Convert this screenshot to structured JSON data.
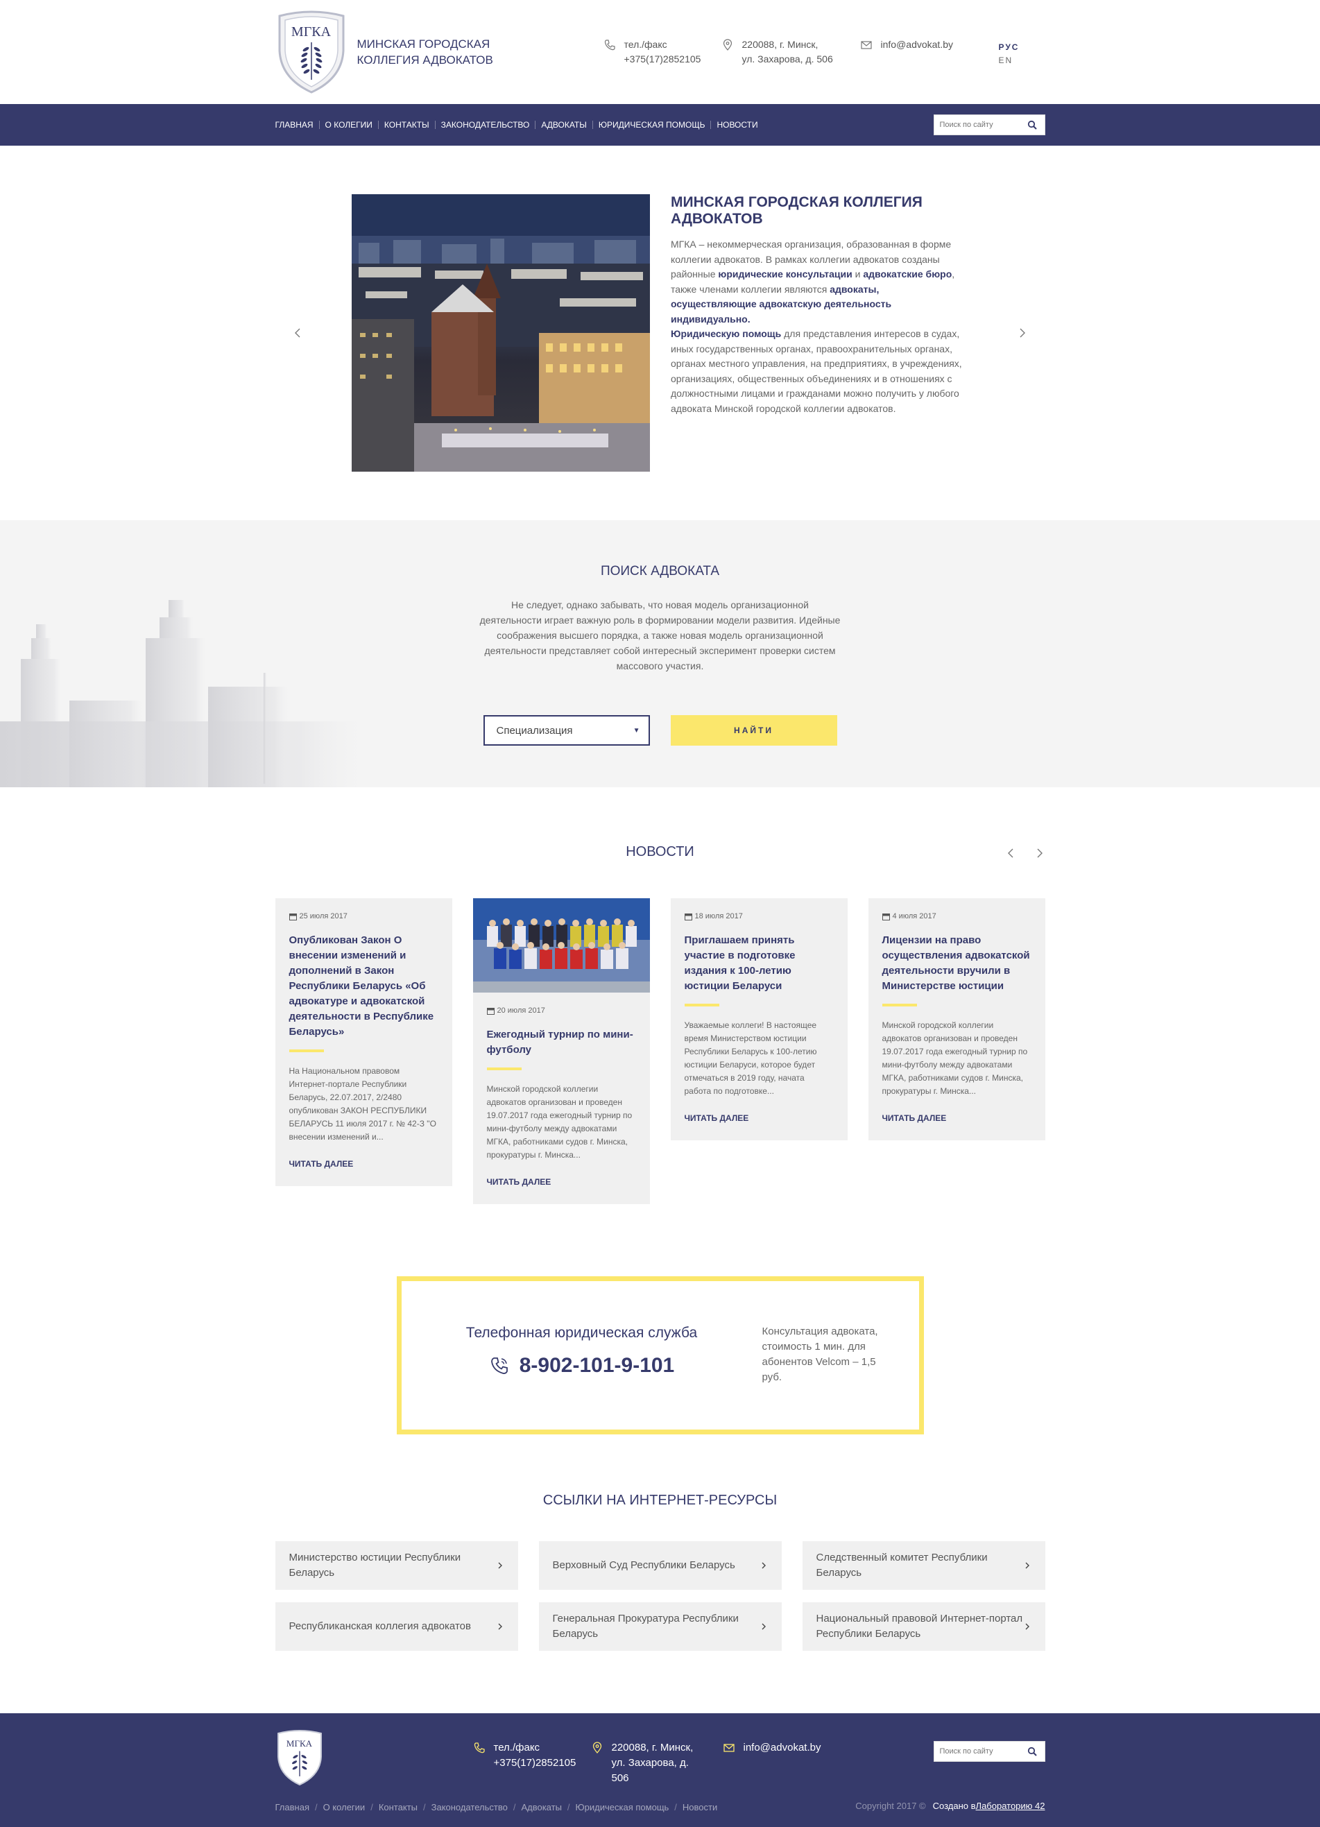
{
  "header": {
    "logo_text": "МГКА",
    "brand_line1": "МИНСКАЯ ГОРОДСКАЯ",
    "brand_line2": "КОЛЛЕГИЯ АДВОКАТОВ",
    "phone_label": "тел./факс",
    "phone_value": "+375(17)2852105",
    "addr_line1": "220088, г. Минск,",
    "addr_line2": "ул. Захарова, д. 506",
    "email": "info@advokat.by",
    "lang_active": "РУС",
    "lang_other": "EN"
  },
  "nav": {
    "items": [
      "ГЛАВНАЯ",
      "О КОЛЕГИИ",
      "КОНТАКТЫ",
      "ЗАКОНОДАТЕЛЬСТВО",
      "АДВОКАТЫ",
      "ЮРИДИЧЕСКАЯ ПОМОЩЬ",
      "НОВОСТИ"
    ],
    "search_placeholder": "Поиск по сайту"
  },
  "hero": {
    "title": "МИНСКАЯ ГОРОДСКАЯ КОЛЛЕГИЯ АДВОКАТОВ",
    "p1": "МГКА – некоммерческая организация, образованная в форме коллегии адвокатов. В рамках коллегии адвокатов созданы районные ",
    "b1": "юридические консультации",
    "p2": " и ",
    "b2": "адвокатские бюро",
    "p3": ", также членами коллегии являются ",
    "b3": "адвокаты, осуществляющие адвокатскую деятельность индивидуально.",
    "b4": "Юридическую помощь",
    "p4": " для представления интересов в судах, иных государственных органах, правоохранительных органах, органах местного управления, на предприятиях, в учреждениях, организациях, общественных объединениях и в отношениях с должностными лицами и гражданами можно получить у любого адвоката Минской городской коллегии адвокатов."
  },
  "search_section": {
    "title": "ПОИСК АДВОКАТА",
    "text": "Не следует, однако забывать, что новая модель организационной деятельности играет важную роль в формировании модели развития. Идейные соображения высшего порядка, а также новая модель организационной деятельности представляет собой интересный эксперимент проверки систем массового участия.",
    "select_value": "Специализация",
    "button": "НАЙТИ"
  },
  "news": {
    "title": "НОВОСТИ",
    "cards": [
      {
        "date": "25 июля 2017",
        "title": "Опубликован Закон О внесении изменений и дополнений в Закон Республики Беларусь «Об адвокатуре и адвокатской деятельности в Республике Беларусь»",
        "excerpt": "На Национальном правовом Интернет-портале Республики Беларусь, 22.07.2017, 2/2480 опубликован ЗАКОН РЕСПУБЛИКИ БЕЛАРУСЬ 11 июля 2017 г. № 42-З \"О внесении изменений и...",
        "more": "ЧИТАТЬ ДАЛЕЕ"
      },
      {
        "date": "20 июля 2017",
        "title": "Ежегодный турнир по мини-футболу",
        "excerpt": "Минской городской коллегии адвокатов организован и проведен 19.07.2017 года ежегодный турнир по мини-футболу между адвокатами МГКА, работниками судов г. Минска, прокуратуры г. Минска...",
        "more": "ЧИТАТЬ ДАЛЕЕ"
      },
      {
        "date": "18 июля 2017",
        "title": "Приглашаем принять участие в подготовке издания к 100-летию юстиции Беларуси",
        "excerpt": "Уважаемые коллеги! В настоящее время Министерством юстиции Республики Беларусь к 100-летию юстиции Беларуси, которое будет отмечаться в 2019 году, начата работа по подготовке...",
        "more": "ЧИТАТЬ ДАЛЕЕ"
      },
      {
        "date": "4 июля 2017",
        "title": "Лицензии на право осуществления адвокатской деятельности вручили в Министерстве юстиции",
        "excerpt": "Минской городской коллегии адвокатов организован и проведен 19.07.2017 года ежегодный турнир по мини-футболу между адвокатами МГКА, работниками судов г. Минска, прокуратуры г. Минска...",
        "more": "ЧИТАТЬ ДАЛЕЕ"
      }
    ]
  },
  "phone_service": {
    "title": "Телефонная юридическая служба",
    "number": "8-902-101-9-101",
    "note": "Консультация адвоката, стоимость 1 мин. для абонентов Velcom – 1,5 руб."
  },
  "links": {
    "title": "ССЫЛКИ НА ИНТЕРНЕТ-РЕСУРСЫ",
    "items": [
      "Министерство юстиции Республики Беларусь",
      "Верховный Суд Республики Беларусь",
      "Следственный комитет Республики Беларусь",
      "Республиканская коллегия адвокатов",
      "Генеральная Прокуратура Республики Беларусь",
      "Национальный правовой Интернет-портал Республики Беларусь"
    ]
  },
  "footer": {
    "phone_label": "тел./факс",
    "phone_value": "+375(17)2852105",
    "addr_line1": "220088, г. Минск,",
    "addr_line2": "ул. Захарова, д.",
    "addr_line3": "506",
    "email": "info@advokat.by",
    "search_placeholder": "Поиск по сайту",
    "nav": [
      "Главная",
      "О колегии",
      "Контакты",
      "Законодательство",
      "Адвокаты",
      "Юридическая помощь",
      "Новости"
    ],
    "copyright": "Copyright 2017 ©",
    "created_prefix": "Создано в ",
    "created_link": "Лабораторию 42"
  },
  "colors": {
    "navy": "#363a6b",
    "yellow": "#fbe76c",
    "band": "#f4f4f4",
    "card": "#f0f0f0"
  }
}
